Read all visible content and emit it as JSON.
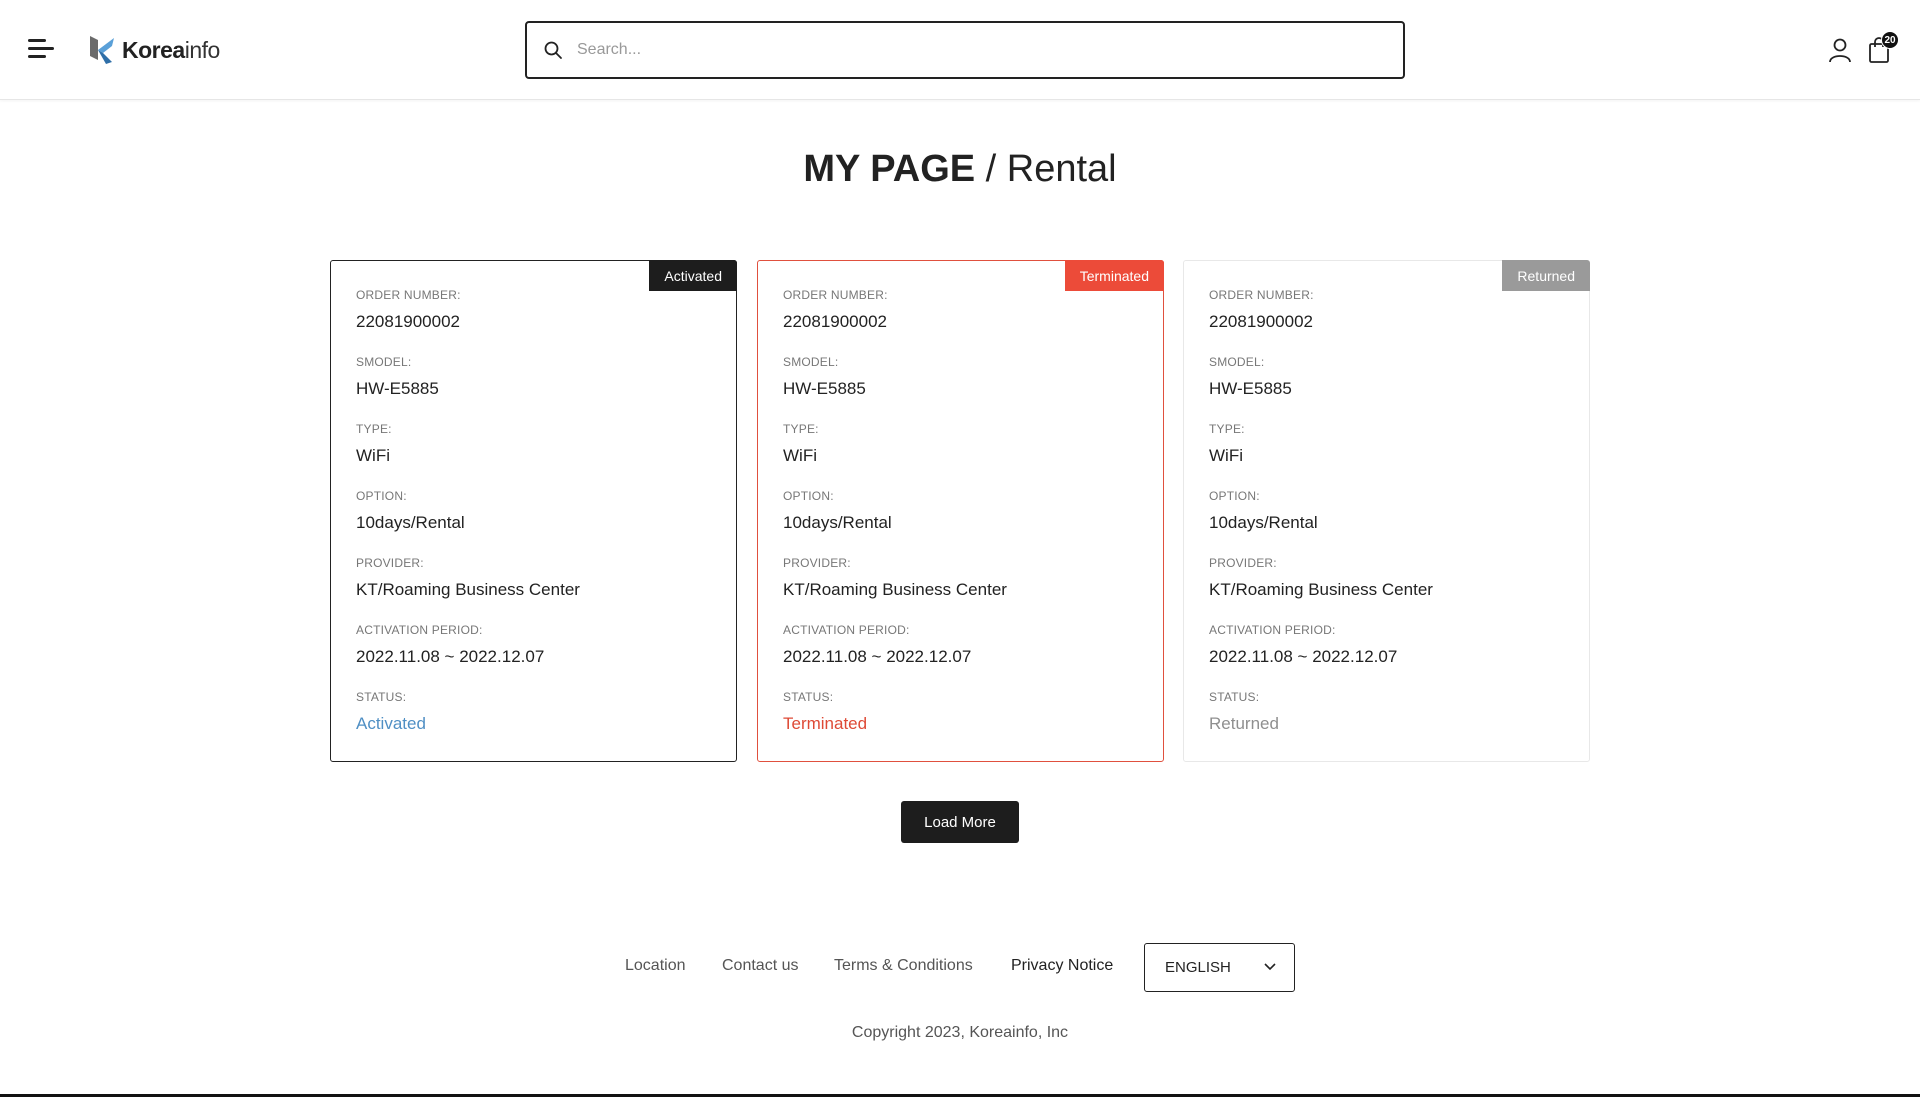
{
  "header": {
    "brand_prefix": "Korea",
    "brand_suffix": "info",
    "search_placeholder": "Search...",
    "cart_count": "20"
  },
  "page": {
    "title_strong": "MY PAGE",
    "title_light": " / Rental"
  },
  "labels": {
    "order_number": "ORDER NUMBER:",
    "smodel": "SMODEL:",
    "type": "TYPE:",
    "option": "OPTION:",
    "provider": "PROVIDER:",
    "activation_period": "ACTIVATION PERIOD:",
    "status": "STATUS:"
  },
  "cards": [
    {
      "badge": "Activated",
      "order_number": "22081900002",
      "smodel": "HW-E5885",
      "type": "WiFi",
      "option": "10days/Rental",
      "provider": "KT/Roaming Business Center",
      "activation_period": "2022.11.08 ~ 2022.12.07",
      "status": "Activated"
    },
    {
      "badge": "Terminated",
      "order_number": "22081900002",
      "smodel": "HW-E5885",
      "type": "WiFi",
      "option": "10days/Rental",
      "provider": "KT/Roaming Business Center",
      "activation_period": "2022.11.08 ~ 2022.12.07",
      "status": "Terminated"
    },
    {
      "badge": "Returned",
      "order_number": "22081900002",
      "smodel": "HW-E5885",
      "type": "WiFi",
      "option": "10days/Rental",
      "provider": "KT/Roaming Business Center",
      "activation_period": "2022.11.08 ~ 2022.12.07",
      "status": "Returned"
    }
  ],
  "load_more": "Load More",
  "footer": {
    "links": [
      "Location",
      "Contact us",
      "Terms & Conditions",
      "Privacy Notice"
    ],
    "language": "ENGLISH",
    "copyright": "Copyright 2023, Koreainfo, Inc"
  },
  "colors": {
    "activated": "#4f8fc4",
    "terminated": "#ec4b39",
    "returned": "#9a9a9a",
    "dark": "#1d1d1d"
  }
}
